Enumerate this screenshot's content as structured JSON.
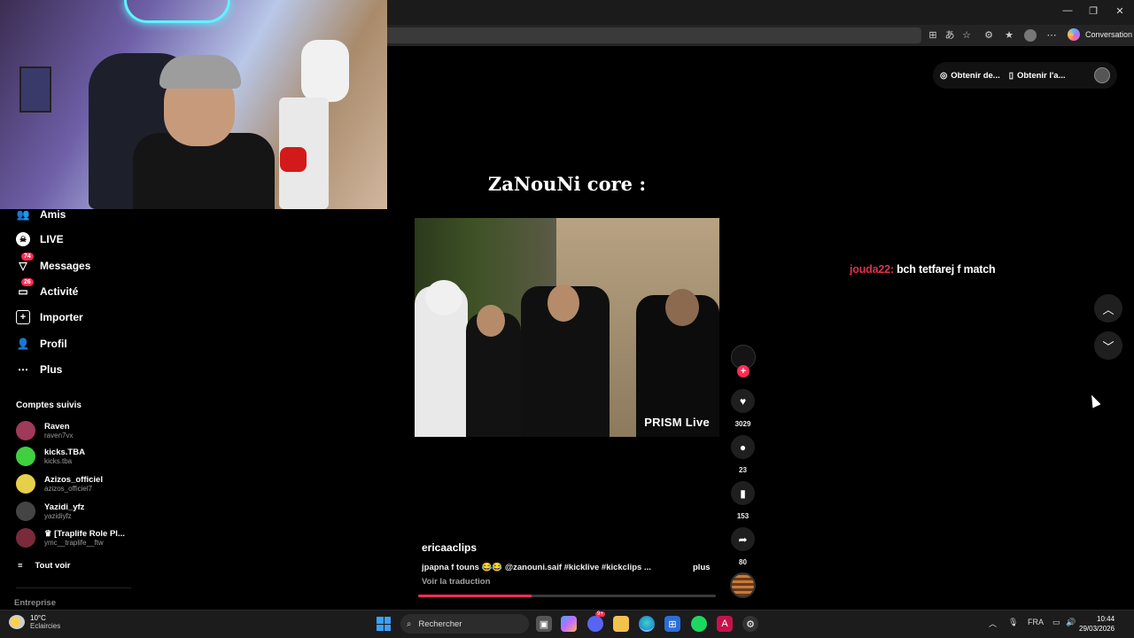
{
  "browser": {
    "copilot_label": "Conversation",
    "window_controls": [
      "—",
      "❐",
      "✕"
    ],
    "toolbar_icons": [
      "app-icon",
      "translate-icon",
      "star-icon",
      "extension-icon",
      "favorites-icon",
      "profile-icon",
      "more-icon"
    ]
  },
  "top_actions": {
    "get_desktop": "Obtenir de...",
    "get_app": "Obtenir l'a..."
  },
  "sidebar": {
    "items": [
      {
        "label": "Amis",
        "icon": "friends-icon"
      },
      {
        "label": "LIVE",
        "icon": "live-icon"
      },
      {
        "label": "Messages",
        "icon": "messages-icon",
        "badge": "74"
      },
      {
        "label": "Activité",
        "icon": "activity-icon",
        "badge": "26"
      },
      {
        "label": "Importer",
        "icon": "upload-icon"
      },
      {
        "label": "Profil",
        "icon": "profile-icon"
      },
      {
        "label": "Plus",
        "icon": "more-icon"
      }
    ],
    "followed_title": "Comptes suivis",
    "accounts": [
      {
        "name": "Raven",
        "handle": "raven7vx",
        "color": "#a03a5a"
      },
      {
        "name": "kicks.TBA",
        "handle": "kicks.tba",
        "color": "#3fcf3f"
      },
      {
        "name": "Azizos_officiel",
        "handle": "azizos_officiel7",
        "color": "#e6d04a"
      },
      {
        "name": "Yazidi_yfz",
        "handle": "yazidiyfz",
        "color": "#444444"
      },
      {
        "name": "♛ [Traplife Role Pl...",
        "handle": "ymc__traplife__ftw",
        "color": "#7a2a3a"
      }
    ],
    "see_all": "Tout voir",
    "entreprise": "Entreprise"
  },
  "video": {
    "title": "ZaNouNi core :",
    "watermark": "PRISM Live",
    "author": "ericaaclips",
    "description": "jpapna f touns 😂😂 @zanouni.saif #kicklive #kickclips ...",
    "more": "plus",
    "translate": "Voir la traduction",
    "progress": 0.38
  },
  "actions": {
    "likes": "3029",
    "comments": "23",
    "saves": "153",
    "shares": "80"
  },
  "chat": {
    "user": "jouda22:",
    "message": "bch tetfarej f match"
  },
  "taskbar": {
    "temp": "10°C",
    "weather": "Eclaircies",
    "search": "Rechercher",
    "lang": "FRA",
    "time": "10:44",
    "date": "29/03/2026",
    "discord_badge": "9+"
  },
  "colors": {
    "accent": "#fe2c55",
    "chat_user": "#e0314b"
  }
}
